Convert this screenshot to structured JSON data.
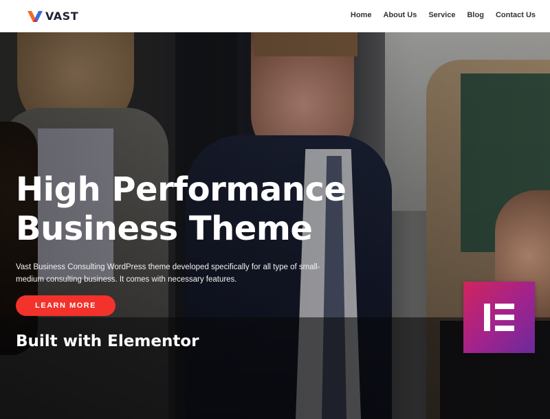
{
  "header": {
    "logo_text": "VAST",
    "nav": [
      "Home",
      "About Us",
      "Service",
      "Blog",
      "Contact Us"
    ]
  },
  "hero": {
    "headline_line1": "High Performance",
    "headline_line2": "Business Theme",
    "subtext": "Vast Business Consulting WordPress theme developed specifically for all type of small-medium consulting business. It comes with necessary features.",
    "cta_label": "LEARN MORE"
  },
  "band": {
    "title": "Built with Elementor"
  },
  "colors": {
    "accent": "#f2322b",
    "logo_orange": "#f26b2a",
    "logo_blue": "#3b6be0",
    "elementor_gradient_start": "#d1245e",
    "elementor_gradient_end": "#6a2a9b"
  },
  "icons": [
    "vast-logo-icon",
    "elementor-logo-icon"
  ]
}
